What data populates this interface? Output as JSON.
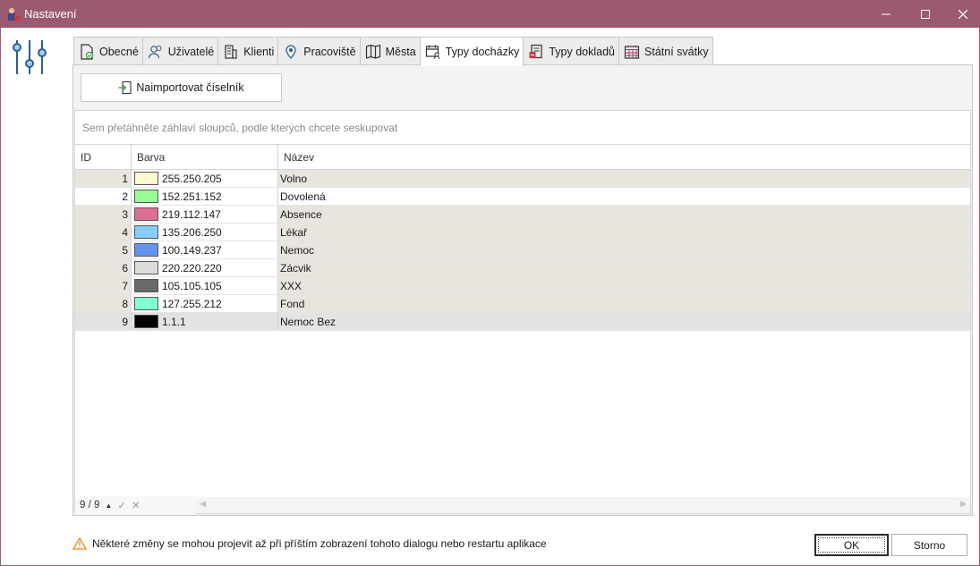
{
  "window": {
    "title": "Nastavení",
    "accent": "#9b5a72"
  },
  "tabs": [
    {
      "label": "Obecné",
      "icon": "document-check-icon"
    },
    {
      "label": "Uživatelé",
      "icon": "users-icon"
    },
    {
      "label": "Klienti",
      "icon": "building-icon"
    },
    {
      "label": "Pracoviště",
      "icon": "location-pin-icon"
    },
    {
      "label": "Města",
      "icon": "map-icon"
    },
    {
      "label": "Typy docházky",
      "icon": "calendar-person-icon",
      "active": true
    },
    {
      "label": "Typy dokladů",
      "icon": "receipt-icon"
    },
    {
      "label": "Státní svátky",
      "icon": "calendar-grid-icon"
    }
  ],
  "toolbar": {
    "import_label": "Naimportovat číselník"
  },
  "grid": {
    "group_hint": "Sem přetáhněte záhlaví sloupců, podle kterých chcete seskupovat",
    "columns": [
      "ID",
      "Barva",
      "Název"
    ],
    "rows": [
      {
        "id": "1",
        "color": "255.250.205",
        "hex": "#fffacd",
        "name": "Volno"
      },
      {
        "id": "2",
        "color": "152.251.152",
        "hex": "#98fb98",
        "name": "Dovolená"
      },
      {
        "id": "3",
        "color": "219.112.147",
        "hex": "#db7093",
        "name": "Absence"
      },
      {
        "id": "4",
        "color": "135.206.250",
        "hex": "#87cefa",
        "name": "Lékař"
      },
      {
        "id": "5",
        "color": "100.149.237",
        "hex": "#6495ed",
        "name": "Nemoc"
      },
      {
        "id": "6",
        "color": "220.220.220",
        "hex": "#dcdcdc",
        "name": "Zácvik"
      },
      {
        "id": "7",
        "color": "105.105.105",
        "hex": "#696969",
        "name": "XXX"
      },
      {
        "id": "8",
        "color": "127.255.212",
        "hex": "#7fffd4",
        "name": "Fond"
      },
      {
        "id": "9",
        "color": "1.1.1",
        "hex": "#010101",
        "name": "Nemoc Bez"
      }
    ],
    "record_counter": "9 / 9"
  },
  "footer": {
    "warning": "Některé změny se mohou projevit až při příštím zobrazení tohoto dialogu nebo restartu aplikace",
    "ok_label": "OK",
    "cancel_label": "Storno"
  }
}
